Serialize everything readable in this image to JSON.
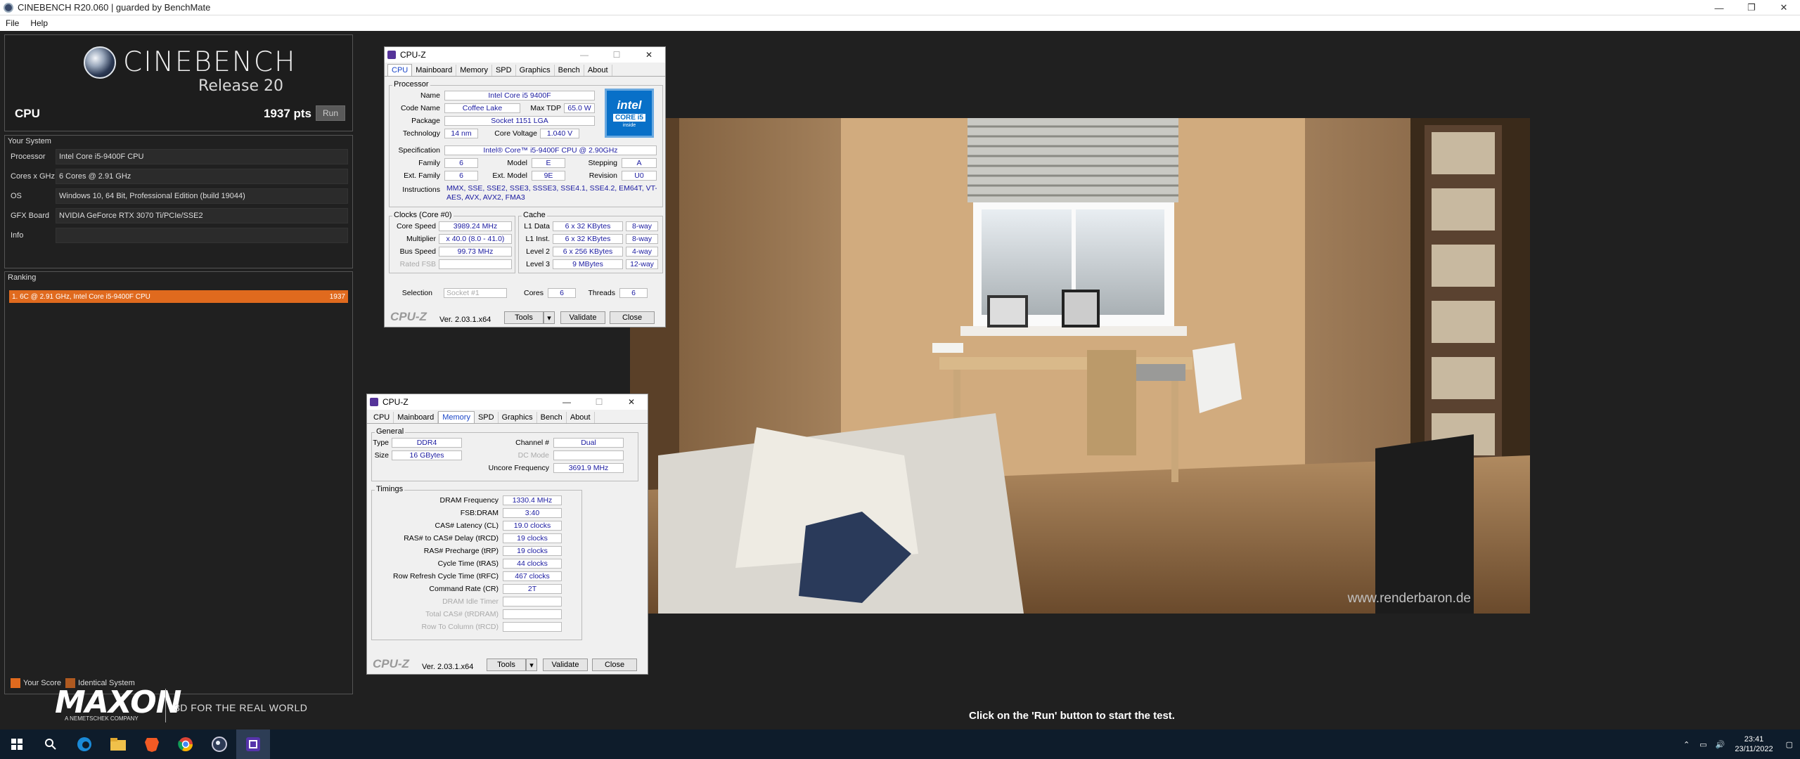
{
  "window": {
    "title": "CINEBENCH R20.060 | guarded by BenchMate"
  },
  "menu": {
    "file": "File",
    "help": "Help"
  },
  "cinebench": {
    "logo_title": "CINEBENCH",
    "logo_release": "Release 20",
    "cpu_label": "CPU",
    "cpu_score": "1937 pts",
    "run_label": "Run",
    "your_system_title": "Your System",
    "system": [
      {
        "key": "Processor",
        "value": "Intel Core i5-9400F CPU"
      },
      {
        "key": "Cores x GHz",
        "value": "6 Cores @ 2.91 GHz"
      },
      {
        "key": "OS",
        "value": "Windows 10, 64 Bit, Professional Edition (build 19044)"
      },
      {
        "key": "GFX Board",
        "value": "NVIDIA GeForce RTX 3070 Ti/PCIe/SSE2"
      },
      {
        "key": "Info",
        "value": ""
      }
    ],
    "ranking_title": "Ranking",
    "ranking": [
      {
        "label": "1. 6C @ 2.91 GHz, Intel Core i5-9400F CPU",
        "score": "1937"
      }
    ],
    "legend_your_score": "Your Score",
    "legend_identical": "Identical System",
    "maxon": "MAXON",
    "maxon_sub": "A NEMETSCHEK COMPANY",
    "tagline": "3D FOR THE REAL WORLD",
    "bottom_message": "Click on the 'Run' button to start the test.",
    "watermark": "www.renderbaron.de",
    "colors": {
      "accent": "#e06a1e",
      "identical": "#b05a20"
    }
  },
  "cpuz1": {
    "title": "CPU-Z",
    "tabs": [
      "CPU",
      "Mainboard",
      "Memory",
      "SPD",
      "Graphics",
      "Bench",
      "About"
    ],
    "active_tab": "CPU",
    "processor_group": "Processor",
    "name_label": "Name",
    "name": "Intel Core i5 9400F",
    "codename_label": "Code Name",
    "codename": "Coffee Lake",
    "maxtdp_label": "Max TDP",
    "maxtdp": "65.0 W",
    "package_label": "Package",
    "package": "Socket 1151 LGA",
    "technology_label": "Technology",
    "technology": "14 nm",
    "corevoltage_label": "Core Voltage",
    "corevoltage": "1.040 V",
    "spec_label": "Specification",
    "spec": "Intel® Core™ i5-9400F CPU @ 2.90GHz",
    "family_label": "Family",
    "family": "6",
    "model_label": "Model",
    "model": "E",
    "stepping_label": "Stepping",
    "stepping": "A",
    "extfamily_label": "Ext. Family",
    "extfamily": "6",
    "extmodel_label": "Ext. Model",
    "extmodel": "9E",
    "revision_label": "Revision",
    "revision": "U0",
    "instructions_label": "Instructions",
    "instructions_1": "MMX, SSE, SSE2, SSE3, SSSE3, SSE4.1, SSE4.2, EM64T, VT-x,",
    "instructions_2": "AES, AVX, AVX2, FMA3",
    "clocks_group": "Clocks (Core #0)",
    "corespeed_label": "Core Speed",
    "corespeed": "3989.24 MHz",
    "multiplier_label": "Multiplier",
    "multiplier": "x 40.0 (8.0 - 41.0)",
    "busspeed_label": "Bus Speed",
    "busspeed": "99.73 MHz",
    "ratedfsb_label": "Rated FSB",
    "ratedfsb": "",
    "cache_group": "Cache",
    "l1data_label": "L1 Data",
    "l1data": "6 x 32 KBytes",
    "l1data_way": "8-way",
    "l1inst_label": "L1 Inst.",
    "l1inst": "6 x 32 KBytes",
    "l1inst_way": "8-way",
    "l2_label": "Level 2",
    "l2": "6 x 256 KBytes",
    "l2_way": "4-way",
    "l3_label": "Level 3",
    "l3": "9 MBytes",
    "l3_way": "12-way",
    "selection_label": "Selection",
    "selection": "Socket #1",
    "cores_label": "Cores",
    "cores": "6",
    "threads_label": "Threads",
    "threads": "6",
    "logo": "CPU-Z",
    "version": "Ver. 2.03.1.x64",
    "tools": "Tools",
    "validate": "Validate",
    "close": "Close",
    "intel_logo": "intel",
    "intel_core": "CORE i5",
    "intel_inside": "inside"
  },
  "cpuz2": {
    "title": "CPU-Z",
    "tabs": [
      "CPU",
      "Mainboard",
      "Memory",
      "SPD",
      "Graphics",
      "Bench",
      "About"
    ],
    "active_tab": "Memory",
    "general_group": "General",
    "type_label": "Type",
    "type": "DDR4",
    "channel_label": "Channel #",
    "channel": "Dual",
    "size_label": "Size",
    "size": "16 GBytes",
    "dcmode_label": "DC Mode",
    "dcmode": "",
    "uncore_label": "Uncore Frequency",
    "uncore": "3691.9 MHz",
    "timings_group": "Timings",
    "timings": [
      {
        "label": "DRAM Frequency",
        "value": "1330.4 MHz",
        "dim": false
      },
      {
        "label": "FSB:DRAM",
        "value": "3:40",
        "dim": false
      },
      {
        "label": "CAS# Latency (CL)",
        "value": "19.0 clocks",
        "dim": false
      },
      {
        "label": "RAS# to CAS# Delay (tRCD)",
        "value": "19 clocks",
        "dim": false
      },
      {
        "label": "RAS# Precharge (tRP)",
        "value": "19 clocks",
        "dim": false
      },
      {
        "label": "Cycle Time (tRAS)",
        "value": "44 clocks",
        "dim": false
      },
      {
        "label": "Row Refresh Cycle Time (tRFC)",
        "value": "467 clocks",
        "dim": false
      },
      {
        "label": "Command Rate (CR)",
        "value": "2T",
        "dim": false
      },
      {
        "label": "DRAM Idle Timer",
        "value": "",
        "dim": true
      },
      {
        "label": "Total CAS# (tRDRAM)",
        "value": "",
        "dim": true
      },
      {
        "label": "Row To Column (tRCD)",
        "value": "",
        "dim": true
      }
    ],
    "logo": "CPU-Z",
    "version": "Ver. 2.03.1.x64",
    "tools": "Tools",
    "validate": "Validate",
    "close": "Close"
  },
  "taskbar": {
    "time": "23:41",
    "date": "23/11/2022",
    "icons": [
      "windows-start-icon",
      "search-icon",
      "edge-icon",
      "file-explorer-icon",
      "brave-icon",
      "chrome-icon",
      "cinebench-icon",
      "cpuz-icon"
    ]
  }
}
